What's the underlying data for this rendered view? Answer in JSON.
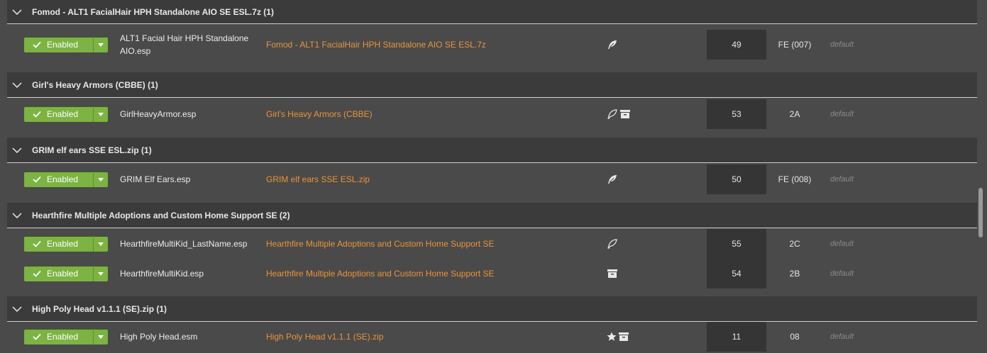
{
  "enabled_label": "Enabled",
  "profile_label": "default",
  "colors": {
    "background": "#4a4a4a",
    "group_header": "#3b3b3b",
    "enabled_green": "#7cb342",
    "mod_link": "#e8943a",
    "load_order_cell": "#353535"
  },
  "groups": [
    {
      "title": "Fomod - ALT1 FacialHair HPH Standalone AIO SE ESL.7z (1)",
      "plugins": [
        {
          "plugin_line1": "ALT1 Facial Hair HPH Standalone",
          "plugin_line2": "AIO.esp",
          "mod": "Fomod - ALT1 FacialHair HPH Standalone AIO SE ESL.7z",
          "flags": [
            "feather-solid-icon"
          ],
          "load_order": "49",
          "mod_index": "FE (007)"
        }
      ]
    },
    {
      "title": "Girl's Heavy Armors (CBBE) (1)",
      "plugins": [
        {
          "plugin_line1": "GirlHeavyArmor.esp",
          "mod": "Girl's Heavy Armors (CBBE)",
          "flags": [
            "feather-outline-icon",
            "archive-icon"
          ],
          "load_order": "53",
          "mod_index": "2A"
        }
      ]
    },
    {
      "title": "GRIM elf ears SSE ESL.zip (1)",
      "plugins": [
        {
          "plugin_line1": "GRIM Elf Ears.esp",
          "mod": "GRIM elf ears SSE ESL.zip",
          "flags": [
            "feather-solid-icon"
          ],
          "load_order": "50",
          "mod_index": "FE (008)"
        }
      ]
    },
    {
      "title": "Hearthfire Multiple Adoptions and Custom Home Support SE (2)",
      "plugins": [
        {
          "plugin_line1": "HearthfireMultiKid_LastName.esp",
          "mod": "Hearthfire Multiple Adoptions and Custom Home Support SE",
          "flags": [
            "feather-outline-icon"
          ],
          "load_order": "55",
          "mod_index": "2C"
        },
        {
          "plugin_line1": "HearthfireMultiKid.esp",
          "mod": "Hearthfire Multiple Adoptions and Custom Home Support SE",
          "flags": [
            "archive-icon"
          ],
          "load_order": "54",
          "mod_index": "2B"
        }
      ]
    },
    {
      "title": "High Poly Head v1.1.1 (SE).zip (1)",
      "plugins": [
        {
          "plugin_line1": "High Poly Head.esm",
          "mod": "High Poly Head v1.1.1 (SE).zip",
          "flags": [
            "star-icon",
            "archive-icon"
          ],
          "load_order": "11",
          "mod_index": "08"
        }
      ]
    }
  ]
}
